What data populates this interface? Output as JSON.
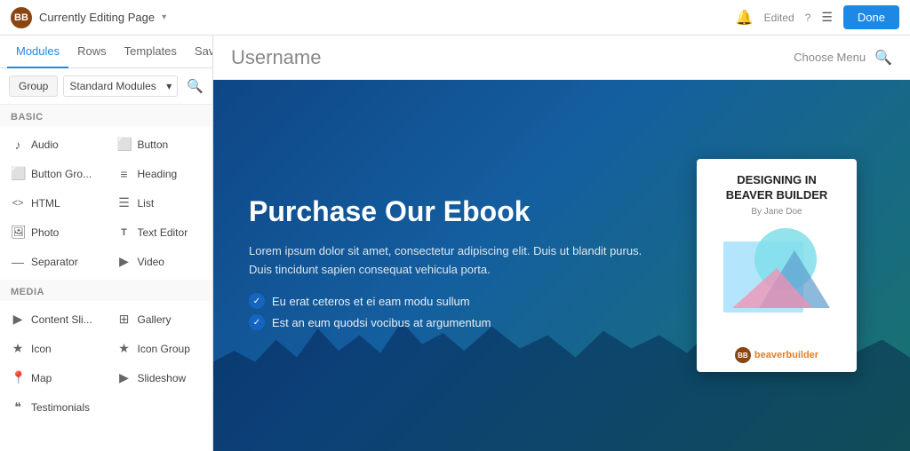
{
  "topbar": {
    "logo_label": "BB",
    "title": "Currently Editing Page",
    "edited_label": "Edited",
    "help_label": "?",
    "done_label": "Done",
    "bell_icon": "🔔",
    "list_icon": "☰",
    "chevron": "▾"
  },
  "sidebar": {
    "tabs": [
      {
        "id": "modules",
        "label": "Modules",
        "active": true
      },
      {
        "id": "rows",
        "label": "Rows",
        "active": false
      },
      {
        "id": "templates",
        "label": "Templates",
        "active": false
      },
      {
        "id": "saved",
        "label": "Saved",
        "active": false
      }
    ],
    "group_btn_label": "Group",
    "group_select_value": "Standard Modules",
    "sections": [
      {
        "label": "Basic",
        "items": [
          {
            "icon": "♪",
            "label": "Audio"
          },
          {
            "icon": "⬜",
            "label": "Button"
          },
          {
            "icon": "⬜",
            "label": "Button Gro..."
          },
          {
            "icon": "≡",
            "label": "Heading"
          },
          {
            "icon": "<>",
            "label": "HTML"
          },
          {
            "icon": "☰",
            "label": "List"
          },
          {
            "icon": "🖼",
            "label": "Photo"
          },
          {
            "icon": "T",
            "label": "Text Editor"
          },
          {
            "icon": "—",
            "label": "Separator"
          },
          {
            "icon": "▶",
            "label": "Video"
          }
        ]
      },
      {
        "label": "Media",
        "items": [
          {
            "icon": "▶",
            "label": "Content Sli..."
          },
          {
            "icon": "⊞",
            "label": "Gallery"
          },
          {
            "icon": "★",
            "label": "Icon"
          },
          {
            "icon": "★",
            "label": "Icon Group"
          },
          {
            "icon": "📍",
            "label": "Map"
          },
          {
            "icon": "▶",
            "label": "Slideshow"
          },
          {
            "icon": "❝",
            "label": "Testimonials"
          }
        ]
      }
    ]
  },
  "canvas": {
    "title": "Username",
    "choose_menu_label": "Choose Menu",
    "hero": {
      "title": "Purchase Our Ebook",
      "description_line1": "Lorem ipsum dolor sit amet, consectetur adipiscing elit. Duis ut blandit purus.",
      "description_line2": "Duis tincidunt sapien consequat vehicula porta.",
      "checklist": [
        "Eu erat ceteros et ei eam modu sullum",
        "Est an eum quodsi vocibus at argumentum"
      ],
      "book": {
        "title": "DESIGNING IN\nBEAVER BUILDER",
        "author": "By Jane Doe",
        "logo_text": "beaverbuilder"
      }
    }
  }
}
